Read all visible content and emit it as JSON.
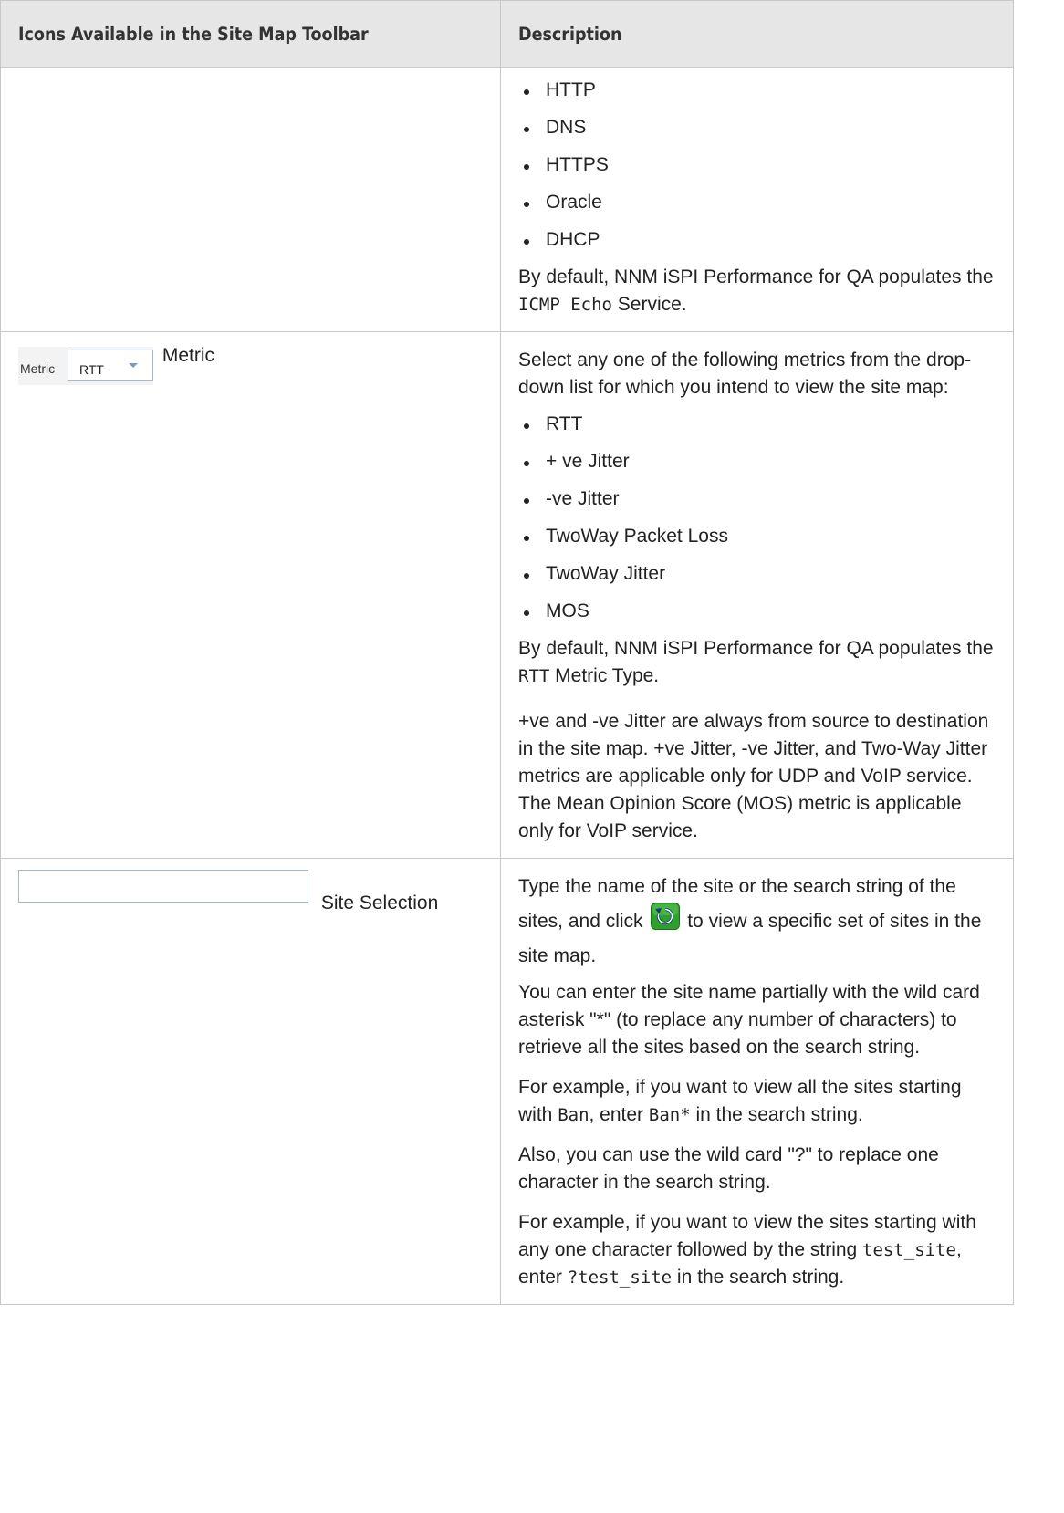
{
  "table": {
    "headers": [
      "Icons Available in the Site Map Toolbar",
      "Description"
    ],
    "row1": {
      "items": [
        "HTTP",
        "DNS",
        "HTTPS",
        "Oracle",
        "DHCP"
      ],
      "default_pre": "By default, NNM iSPI Performance for QA populates the ",
      "default_code": "ICMP Echo",
      "default_post": " Service."
    },
    "row2": {
      "widget_label": "Metric",
      "widget_value": "RTT",
      "name": "Metric",
      "intro": "Select any one of the following metrics from the drop-down list for which you intend to view the site map:",
      "items": [
        "RTT",
        "+ ve Jitter",
        "-ve Jitter",
        "TwoWay Packet Loss",
        "TwoWay Jitter",
        "MOS"
      ],
      "default_pre": "By default, NNM iSPI Performance for QA populates the ",
      "default_code": "RTT",
      "default_post": " Metric Type.",
      "note": "+ve and -ve Jitter are always from source to destination in the site map. +ve Jitter, -ve Jitter, and Two-Way Jitter metrics are applicable only for UDP and VoIP service. The Mean Opinion Score (MOS) metric is applicable only for VoIP service."
    },
    "row3": {
      "name": "Site Selection",
      "p1_pre": "Type the name of the site or the search string of the sites, and click ",
      "p1_post": " to view a specific set of sites in the site map.",
      "p2": "You can enter the site name partially with the wild card asterisk \"*\" (to replace any number of characters) to retrieve all the sites based on the search string.",
      "p3_pre": "For example, if you want to view all the sites starting with ",
      "p3_code1": "Ban",
      "p3_mid": ", enter ",
      "p3_code2": "Ban*",
      "p3_post": " in the search string.",
      "p4": "Also, you can use the wild card \"?\" to replace one character in the search string.",
      "p5_pre": "For example, if you want to view the sites starting with any one character followed by the string ",
      "p5_code1": "test_site",
      "p5_mid": ", enter ",
      "p5_code2": "?test_site",
      "p5_post": " in the search string."
    }
  },
  "icons": {
    "refresh": "refresh-icon",
    "dropdown": "chevron-down-icon"
  },
  "colors": {
    "header_bg": "#e6e6e6",
    "border": "#c8c8c8",
    "refresh_green": "#2ea02e"
  }
}
